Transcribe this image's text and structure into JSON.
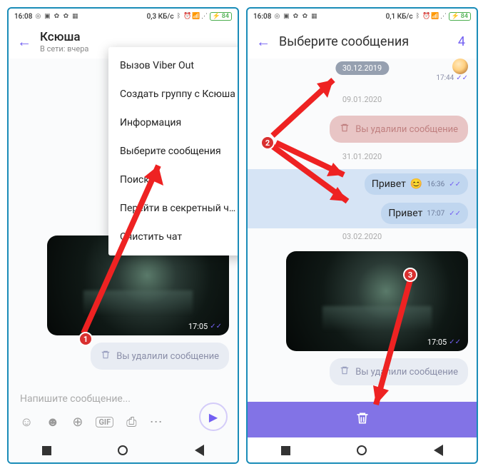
{
  "status": {
    "time": "16:08",
    "data_rate": "0,3 КБ/с",
    "data_rate2": "0,1 КБ/с",
    "battery": "84"
  },
  "left": {
    "chat_name": "Ксюша",
    "chat_status": "В сети: вчера",
    "menu": {
      "viber_out": "Вызов Viber Out",
      "create_group": "Создать группу с Ксюша",
      "info": "Информация",
      "select_msgs": "Выберите сообщения",
      "search": "Поиск",
      "secret_chat": "Перейти в секретный чат",
      "clear_chat": "Очистить чат"
    },
    "image_time": "17:05",
    "deleted_text": "Вы удалили сообщение",
    "composer_placeholder": "Напишите сообщение...",
    "composer_gif": "GIF"
  },
  "right": {
    "title": "Выберите сообщения",
    "count": "4",
    "dates": {
      "d1": "30.12.2019",
      "d2": "09.01.2020",
      "d3": "31.01.2020",
      "d4": "03.02.2020"
    },
    "deleted_red": "Вы удалили сообщение",
    "msg1": {
      "text": "Привет",
      "time": "16:36"
    },
    "msg2": {
      "text": "Привет",
      "time": "17:07"
    },
    "prev_time": "17:44",
    "image_time": "17:05",
    "deleted_text": "Вы удалили сообщение"
  },
  "badge1": "1",
  "badge2": "2",
  "badge3": "3"
}
